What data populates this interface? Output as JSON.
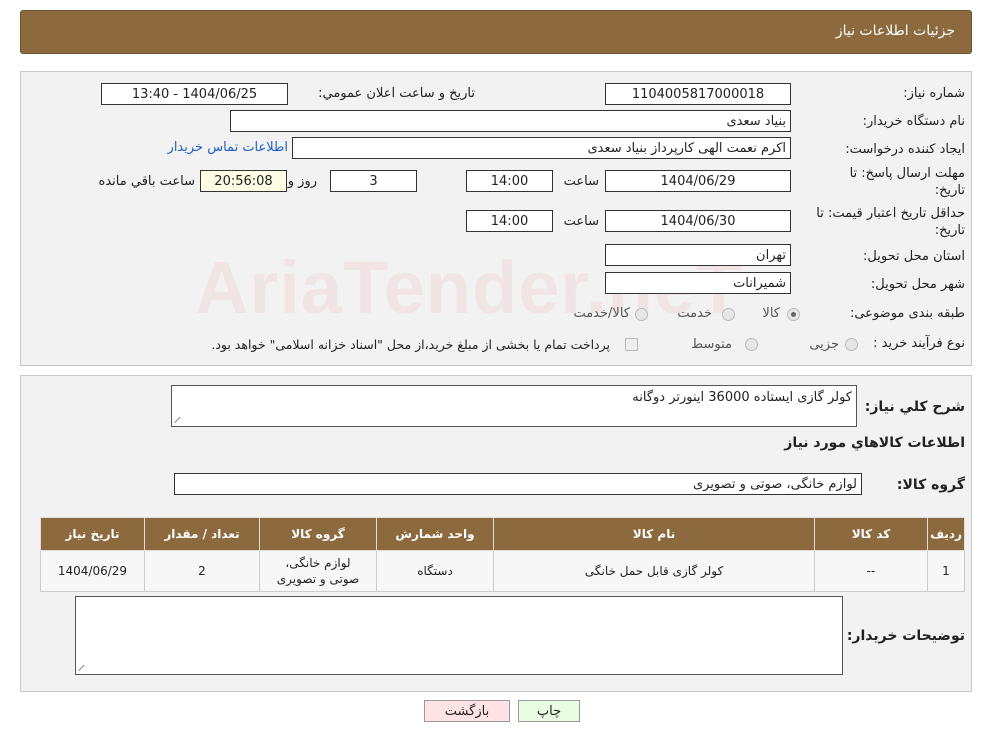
{
  "header": {
    "title": "جزئیات اطلاعات نیاز"
  },
  "watermark": "AriaTender.neT",
  "form": {
    "need_number_label": "شماره نیاز:",
    "need_number": "1104005817000018",
    "announce_label": "تاريخ و ساعت اعلان عمومي:",
    "announce_value": "1404/06/25 - 13:40",
    "buyer_org_label": "نام دستگاه خریدار:",
    "buyer_org": "بنیاد سعدی",
    "creator_label": "ايجاد کننده درخواست:",
    "creator": "اکرم نعمت الهی کارپرداز بنیاد سعدی",
    "contact_link": "اطلاعات تماس خریدار",
    "reply_deadline_label_1": "مهلت ارسال پاسخ: تا",
    "reply_deadline_label_2": "تاریخ:",
    "reply_date": "1404/06/29",
    "time_label": "ساعت",
    "reply_time": "14:00",
    "days_value": "3",
    "days_label": "روز و",
    "remaining_time": "20:56:08",
    "remaining_label": "ساعت باقي مانده",
    "validity_label_1": "حداقل تاریخ اعتبار قیمت: تا",
    "validity_label_2": "تاریخ:",
    "validity_date": "1404/06/30",
    "validity_time": "14:00",
    "province_label": "استان محل تحویل:",
    "province": "تهران",
    "city_label": "شهر محل تحویل:",
    "city": "شمیرانات",
    "category_label": "طبقه بندی موضوعی:",
    "category_options": [
      "کالا",
      "خدمت",
      "کالا/خدمت"
    ],
    "category_selected": "کالا",
    "process_label": "نوع فرآیند خرید :",
    "process_options": [
      "جزیی",
      "متوسط"
    ],
    "process_note": "پرداخت تمام یا بخشی از مبلغ خرید،از محل \"اسناد خزانه اسلامی\" خواهد بود."
  },
  "summary": {
    "desc_label": "شرح کلي نياز:",
    "desc_value": "کولر گازی ایستاده 36000 اینورتر دوگانه",
    "items_title": "اطلاعات کالاهاي مورد نياز",
    "group_label": "گروه کالا:",
    "group_value": "لوازم خانگی، صوتی و تصویری"
  },
  "table": {
    "headers": [
      "ردیف",
      "کد کالا",
      "نام کالا",
      "واحد شمارش",
      "گروه کالا",
      "تعداد / مقدار",
      "تاریخ نیاز"
    ],
    "rows": [
      {
        "row": "1",
        "code": "--",
        "name": "کولر گازی قابل حمل خانگی",
        "unit": "دستگاه",
        "group_line1": "لوازم خانگی،",
        "group_line2": "صوتی و تصویری",
        "qty": "2",
        "date": "1404/06/29"
      }
    ]
  },
  "buyer_notes": {
    "label": "توضیحات خریدار:",
    "value": ""
  },
  "buttons": {
    "print": "چاپ",
    "back": "بازگشت"
  },
  "colors": {
    "header_bg": "#8c6a3e",
    "link": "#1f5ec4",
    "back_btn": "#fde3e3",
    "print_btn": "#e9fde3"
  }
}
